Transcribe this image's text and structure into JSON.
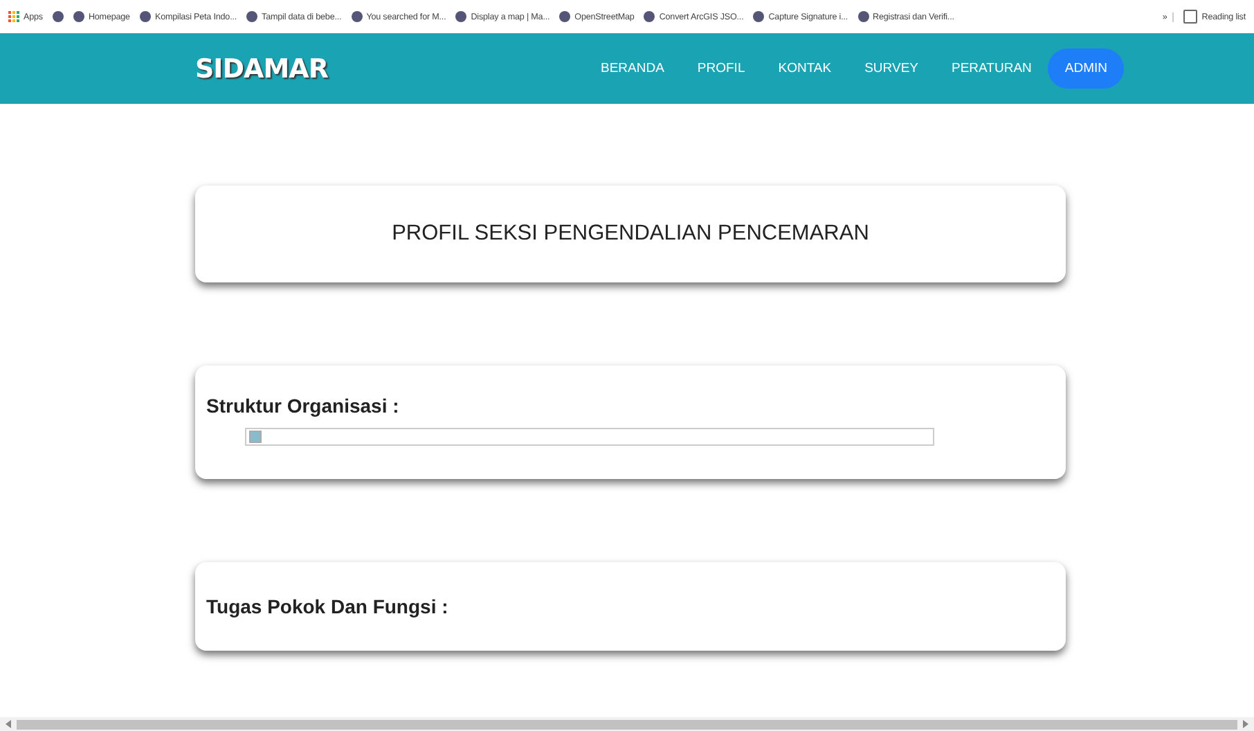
{
  "bookmarks_bar": {
    "items": [
      {
        "kind": "apps",
        "label": "Apps"
      },
      {
        "kind": "page"
      },
      {
        "kind": "page",
        "label": "Homepage"
      },
      {
        "kind": "page",
        "label": "Kompilasi Peta Indo..."
      },
      {
        "kind": "page",
        "label": "Tampil data di bebe..."
      },
      {
        "kind": "page",
        "label": "You searched for M..."
      },
      {
        "kind": "page",
        "label": "Display a map | Ma..."
      },
      {
        "kind": "page",
        "label": "OpenStreetMap"
      },
      {
        "kind": "page",
        "label": "Convert ArcGIS JSO..."
      },
      {
        "kind": "page",
        "label": "Capture Signature i..."
      },
      {
        "kind": "page",
        "label": "Registrasi dan Verifi..."
      },
      {
        "kind": "overflow",
        "label": "»"
      },
      {
        "kind": "reading",
        "label": "Reading list"
      }
    ]
  },
  "navbar": {
    "brand": "SIDAMAR",
    "links": [
      {
        "label": "BERANDA",
        "selected": false
      },
      {
        "label": "PROFIL",
        "selected": false
      },
      {
        "label": "KONTAK",
        "selected": false
      },
      {
        "label": "SURVEY",
        "selected": false
      },
      {
        "label": "PERATURAN",
        "selected": false
      },
      {
        "label": "ADMIN",
        "selected": true
      }
    ]
  },
  "page_title": "PROFIL SEKSI PENGENDALIAN PENCEMARAN",
  "sections": [
    {
      "heading": "Struktur Organisasi :",
      "kind": "image"
    },
    {
      "heading": "Tugas Pokok Dan Fungsi :",
      "kind": "text"
    }
  ]
}
